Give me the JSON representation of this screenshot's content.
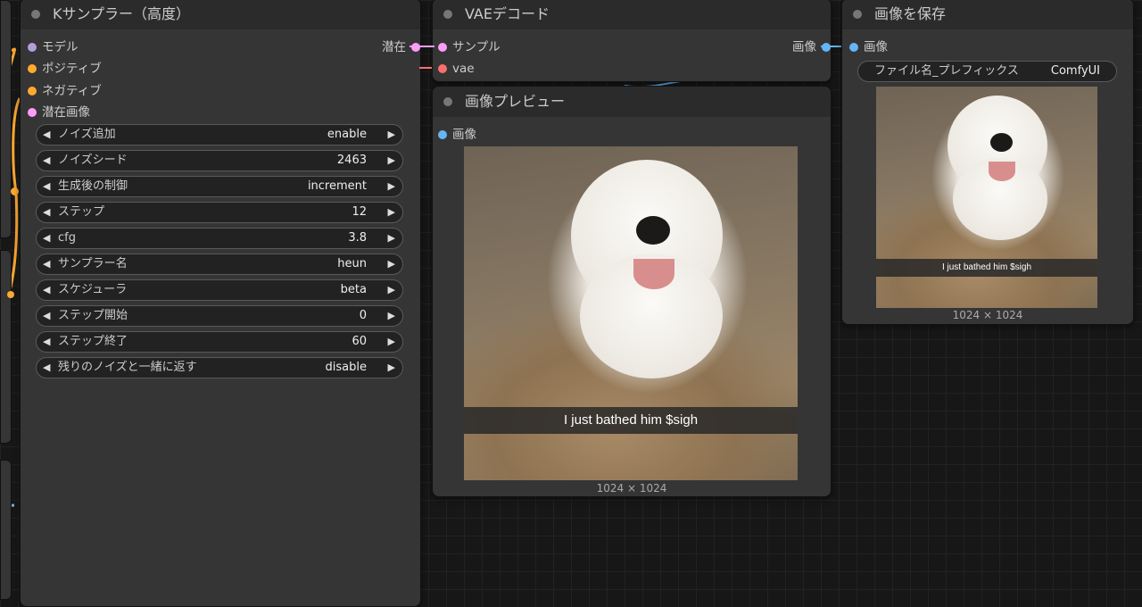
{
  "colors": {
    "model": "#b39ddb",
    "conditioning": "#ffa931",
    "latent": "#ff9cf9",
    "vae": "#ff6e6e",
    "image": "#64b5f6"
  },
  "ksampler": {
    "title": "Kサンプラー（高度）",
    "inputs": [
      "モデル",
      "ポジティブ",
      "ネガティブ",
      "潜在画像"
    ],
    "output": "潜在",
    "widgets": [
      {
        "label": "ノイズ追加",
        "value": "enable"
      },
      {
        "label": "ノイズシード",
        "value": "2463"
      },
      {
        "label": "生成後の制御",
        "value": "increment"
      },
      {
        "label": "ステップ",
        "value": "12"
      },
      {
        "label": "cfg",
        "value": "3.8"
      },
      {
        "label": "サンプラー名",
        "value": "heun"
      },
      {
        "label": "スケジューラ",
        "value": "beta"
      },
      {
        "label": "ステップ開始",
        "value": "0"
      },
      {
        "label": "ステップ終了",
        "value": "60"
      },
      {
        "label": "残りのノイズと一緒に返す",
        "value": "disable"
      }
    ]
  },
  "vae_decode": {
    "title": "VAEデコード",
    "inputs": [
      "サンプル",
      "vae"
    ],
    "output": "画像"
  },
  "preview": {
    "title": "画像プレビュー",
    "input": "画像",
    "caption": "I just bathed him $sigh",
    "dimensions": "1024 × 1024"
  },
  "save": {
    "title": "画像を保存",
    "input": "画像",
    "prefix_label": "ファイル名_プレフィックス",
    "prefix_value": "ComfyUI",
    "caption": "I just bathed him $sigh",
    "dimensions": "1024 × 1024"
  }
}
